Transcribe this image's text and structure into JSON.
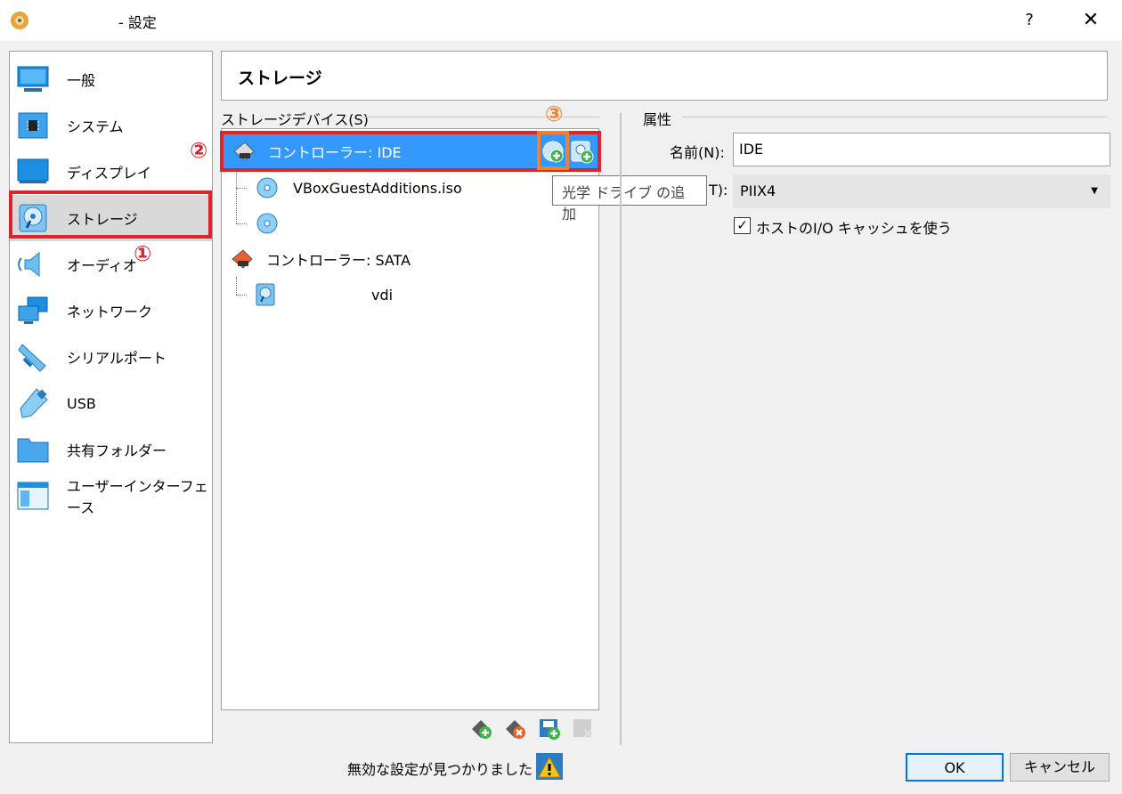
{
  "window": {
    "title": "- 設定",
    "help": "?",
    "close": "✕"
  },
  "sidebar": {
    "items": [
      {
        "label": "一般",
        "icon": "monitor-icon"
      },
      {
        "label": "システム",
        "icon": "chip-icon"
      },
      {
        "label": "ディスプレイ",
        "icon": "display-icon"
      },
      {
        "label": "ストレージ",
        "icon": "disk-icon",
        "selected": true
      },
      {
        "label": "オーディオ",
        "icon": "speaker-icon"
      },
      {
        "label": "ネットワーク",
        "icon": "network-icon"
      },
      {
        "label": "シリアルポート",
        "icon": "serial-port-icon"
      },
      {
        "label": "USB",
        "icon": "usb-icon"
      },
      {
        "label": "共有フォルダー",
        "icon": "folder-icon"
      },
      {
        "label": "ユーザーインターフェース",
        "icon": "window-ui-icon"
      }
    ]
  },
  "page": {
    "title": "ストレージ"
  },
  "storage_devices": {
    "group_title": "ストレージデバイス(S)",
    "controller_ide": "コントローラー: IDE",
    "ide_child_1": "VBoxGuestAdditions.iso",
    "ide_child_2": "",
    "controller_sata": "コントローラー: SATA",
    "sata_child_1": "vdi"
  },
  "tooltip": "光学 ドライブ の追加",
  "attributes": {
    "group_title": "属性",
    "name_label": "名前(N):",
    "name_value": "IDE",
    "type_label": "T):",
    "type_value": "PIIX4",
    "cache_label": "ホストのI/O キャッシュを使う",
    "cache_checked": true
  },
  "annotations": {
    "one": "①",
    "two": "②",
    "three": "③"
  },
  "status": {
    "text": "無効な設定が見つかりました"
  },
  "buttons": {
    "ok": "OK",
    "cancel": "キャンセル"
  },
  "colors": {
    "selection": "#3399ff",
    "annotation_red": "#e0222b",
    "annotation_orange": "#f57f2a"
  }
}
